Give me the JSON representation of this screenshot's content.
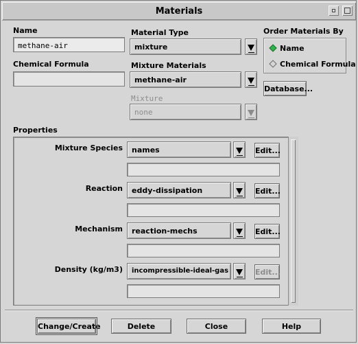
{
  "window": {
    "title": "Materials"
  },
  "name": {
    "label": "Name",
    "value": "methane-air"
  },
  "chemical_formula": {
    "label": "Chemical Formula",
    "value": ""
  },
  "material_type": {
    "label": "Material Type",
    "value": "mixture"
  },
  "mixture_materials": {
    "label": "Mixture Materials",
    "value": "methane-air"
  },
  "mixture": {
    "label": "Mixture",
    "value": "none"
  },
  "order_by": {
    "label": "Order Materials By",
    "options": [
      {
        "label": "Name",
        "selected": true
      },
      {
        "label": "Chemical Formula",
        "selected": false
      }
    ]
  },
  "database_button": "Database...",
  "properties": {
    "label": "Properties",
    "rows": [
      {
        "label": "Mixture Species",
        "value": "names",
        "edit": "Edit...",
        "edit_enabled": true
      },
      {
        "label": "Reaction",
        "value": "eddy-dissipation",
        "edit": "Edit...",
        "edit_enabled": true
      },
      {
        "label": "Mechanism",
        "value": "reaction-mechs",
        "edit": "Edit...",
        "edit_enabled": true
      },
      {
        "label": "Density (kg/m3)",
        "value": "incompressible-ideal-gas",
        "edit": "Edit...",
        "edit_enabled": false
      }
    ]
  },
  "buttons": {
    "change_create": "Change/Create",
    "delete": "Delete",
    "close": "Close",
    "help": "Help"
  }
}
